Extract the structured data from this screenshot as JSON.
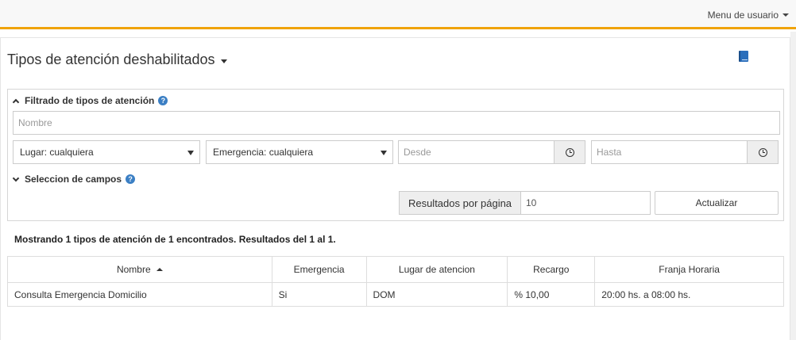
{
  "topbar": {
    "user_menu_label": "Menu de usuario"
  },
  "page": {
    "title": "Tipos de atención deshabilitados"
  },
  "filter": {
    "heading": "Filtrado de tipos de atención",
    "nombre_placeholder": "Nombre",
    "lugar_selected": "Lugar: cualquiera",
    "emergencia_selected": "Emergencia: cualquiera",
    "desde_placeholder": "Desde",
    "hasta_placeholder": "Hasta",
    "fields_heading": "Seleccion de campos",
    "rpp_label": "Resultados por página",
    "rpp_value": "10",
    "update_button": "Actualizar"
  },
  "summary": "Mostrando 1 tipos de atención de 1 encontrados. Resultados del 1 al 1.",
  "table": {
    "headers": [
      "Nombre",
      "Emergencia",
      "Lugar de atencion",
      "Recargo",
      "Franja Horaria"
    ],
    "rows": [
      [
        "Consulta Emergencia Domicilio",
        "Si",
        "DOM",
        "% 10,00",
        "20:00 hs. a 08:00 hs."
      ]
    ]
  },
  "colors": {
    "accent": "#f0a30a",
    "help": "#3b7fc4",
    "icon_blue": "#2a6ebb"
  }
}
